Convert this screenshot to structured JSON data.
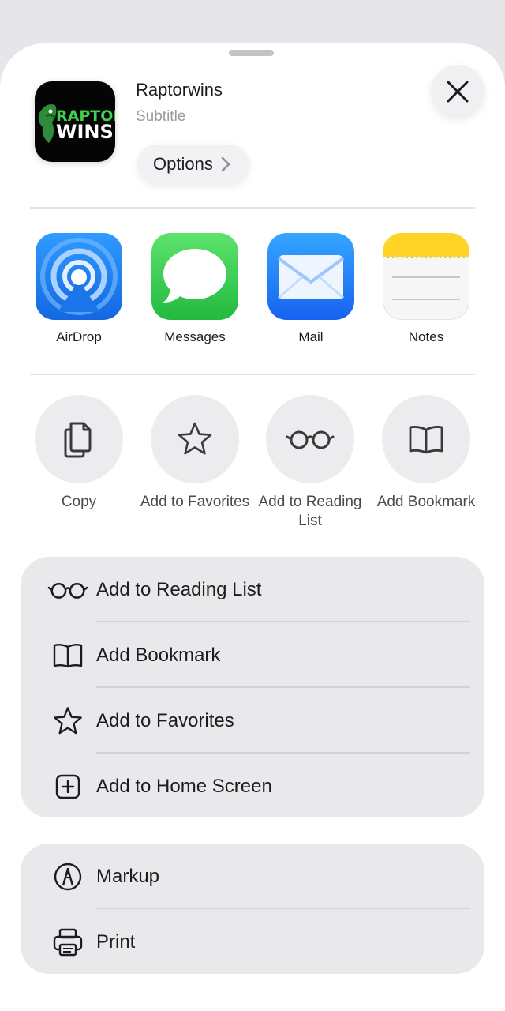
{
  "header": {
    "app_title": "Raptorwins",
    "app_subtitle": "Subtitle",
    "options_label": "Options",
    "logo_line1": "RAPTOR",
    "logo_line2": "WINS"
  },
  "share_apps": [
    {
      "label": "AirDrop",
      "icon": "airdrop-icon"
    },
    {
      "label": "Messages",
      "icon": "messages-icon"
    },
    {
      "label": "Mail",
      "icon": "mail-icon"
    },
    {
      "label": "Notes",
      "icon": "notes-icon"
    }
  ],
  "quick_actions": [
    {
      "label": "Copy",
      "icon": "copy-icon"
    },
    {
      "label": "Add to Favorites",
      "icon": "star-icon"
    },
    {
      "label": "Add to Reading List",
      "icon": "glasses-icon"
    },
    {
      "label": "Add Bookmark",
      "icon": "book-icon"
    }
  ],
  "list_group_1": [
    {
      "label": "Add to Reading List",
      "icon": "glasses-icon"
    },
    {
      "label": "Add Bookmark",
      "icon": "book-icon"
    },
    {
      "label": "Add to Favorites",
      "icon": "star-icon"
    },
    {
      "label": "Add to Home Screen",
      "icon": "plus-square-icon"
    }
  ],
  "list_group_2": [
    {
      "label": "Markup",
      "icon": "markup-icon"
    },
    {
      "label": "Print",
      "icon": "printer-icon"
    }
  ],
  "colors": {
    "background": "#e5e5ea",
    "sheet": "#ffffff",
    "list_group": "#e9e9eb",
    "airdrop": "#1e7cf2",
    "messages": "#34c759",
    "mail": "#1a8cff",
    "notes_header": "#ffd426"
  }
}
